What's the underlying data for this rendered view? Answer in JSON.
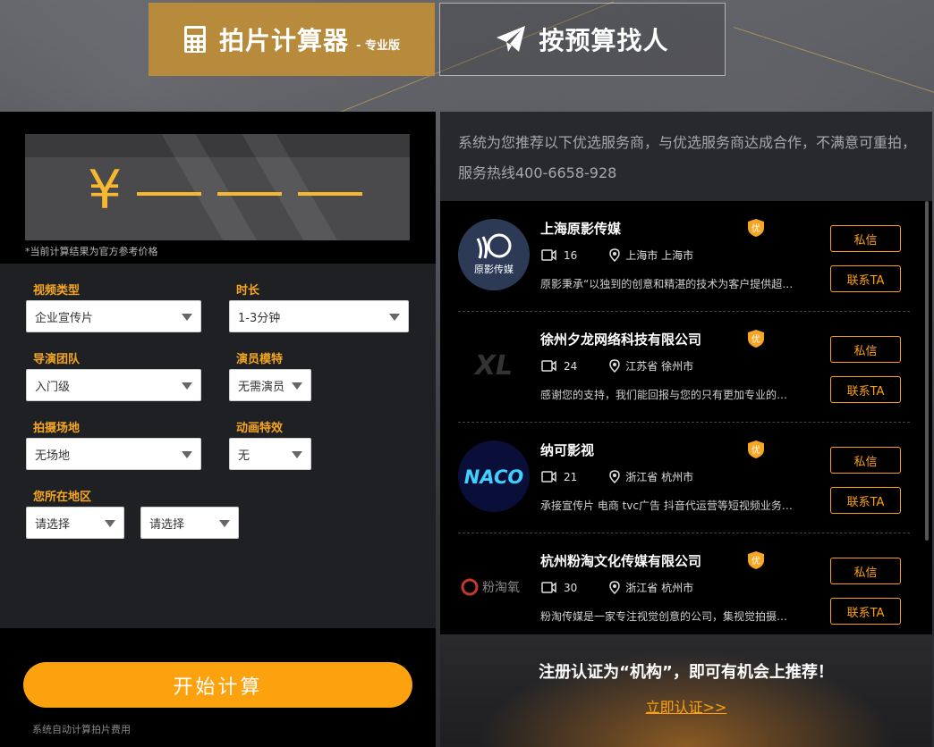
{
  "colors": {
    "accent": "#fca20f",
    "gold": "#b88a3c",
    "price": "#f5b82e"
  },
  "tabs": {
    "calculator": {
      "title": "拍片计算器",
      "sub": "- 专业版",
      "icon": "calculator-icon"
    },
    "find": {
      "title": "按预算找人",
      "icon": "paper-plane-icon"
    }
  },
  "price": {
    "symbol": "¥",
    "note": "*当前计算结果为官方参考价格"
  },
  "form": {
    "video_type": {
      "label": "视频类型",
      "value": "企业宣传片"
    },
    "duration": {
      "label": "时长",
      "value": "1-3分钟"
    },
    "director_team": {
      "label": "导演团队",
      "value": "入门级"
    },
    "actors": {
      "label": "演员模特",
      "value": "无需演员"
    },
    "location": {
      "label": "拍摄场地",
      "value": "无场地"
    },
    "animation": {
      "label": "动画特效",
      "value": "无"
    },
    "region": {
      "label": "您所在地区",
      "province": "请选择",
      "city": "请选择"
    }
  },
  "calc_button": "开始计算",
  "calc_note": "系统自动计算拍片费用",
  "intro": "系统为您推荐以下优选服务商，与优选服务商达成合作，不满意可重拍，服务热线400-6658-928",
  "providers": [
    {
      "name": "上海原影传媒",
      "count": "16",
      "location": "上海市 上海市",
      "desc": "原影秉承“以独到的创意和精湛的技术为客户提供超…",
      "badge": "优",
      "logo_text": "原影传媒"
    },
    {
      "name": "徐州夕龙网络科技有限公司",
      "count": "24",
      "location": "江苏省 徐州市",
      "desc": "感谢您的支持，我们能回报与您的只有更加专业的…",
      "badge": "优",
      "logo_text": "XL"
    },
    {
      "name": "纳可影视",
      "count": "21",
      "location": "浙江省 杭州市",
      "desc": "承接宣传片 电商 tvc广告 抖音代运营等短视频业务…",
      "badge": "优",
      "logo_text": "NACO"
    },
    {
      "name": "杭州粉淘文化传媒有限公司",
      "count": "30",
      "location": "浙江省 杭州市",
      "desc": "粉淘传媒是一家专注视觉创意的公司，集视觉拍摄…",
      "badge": "优",
      "logo_text": "粉淘氧"
    }
  ],
  "provider_buttons": {
    "message": "私信",
    "contact": "联系TA"
  },
  "promo": {
    "title": "注册认证为“机构”，即可有机会上推荐！",
    "link": "立即认证>>"
  }
}
